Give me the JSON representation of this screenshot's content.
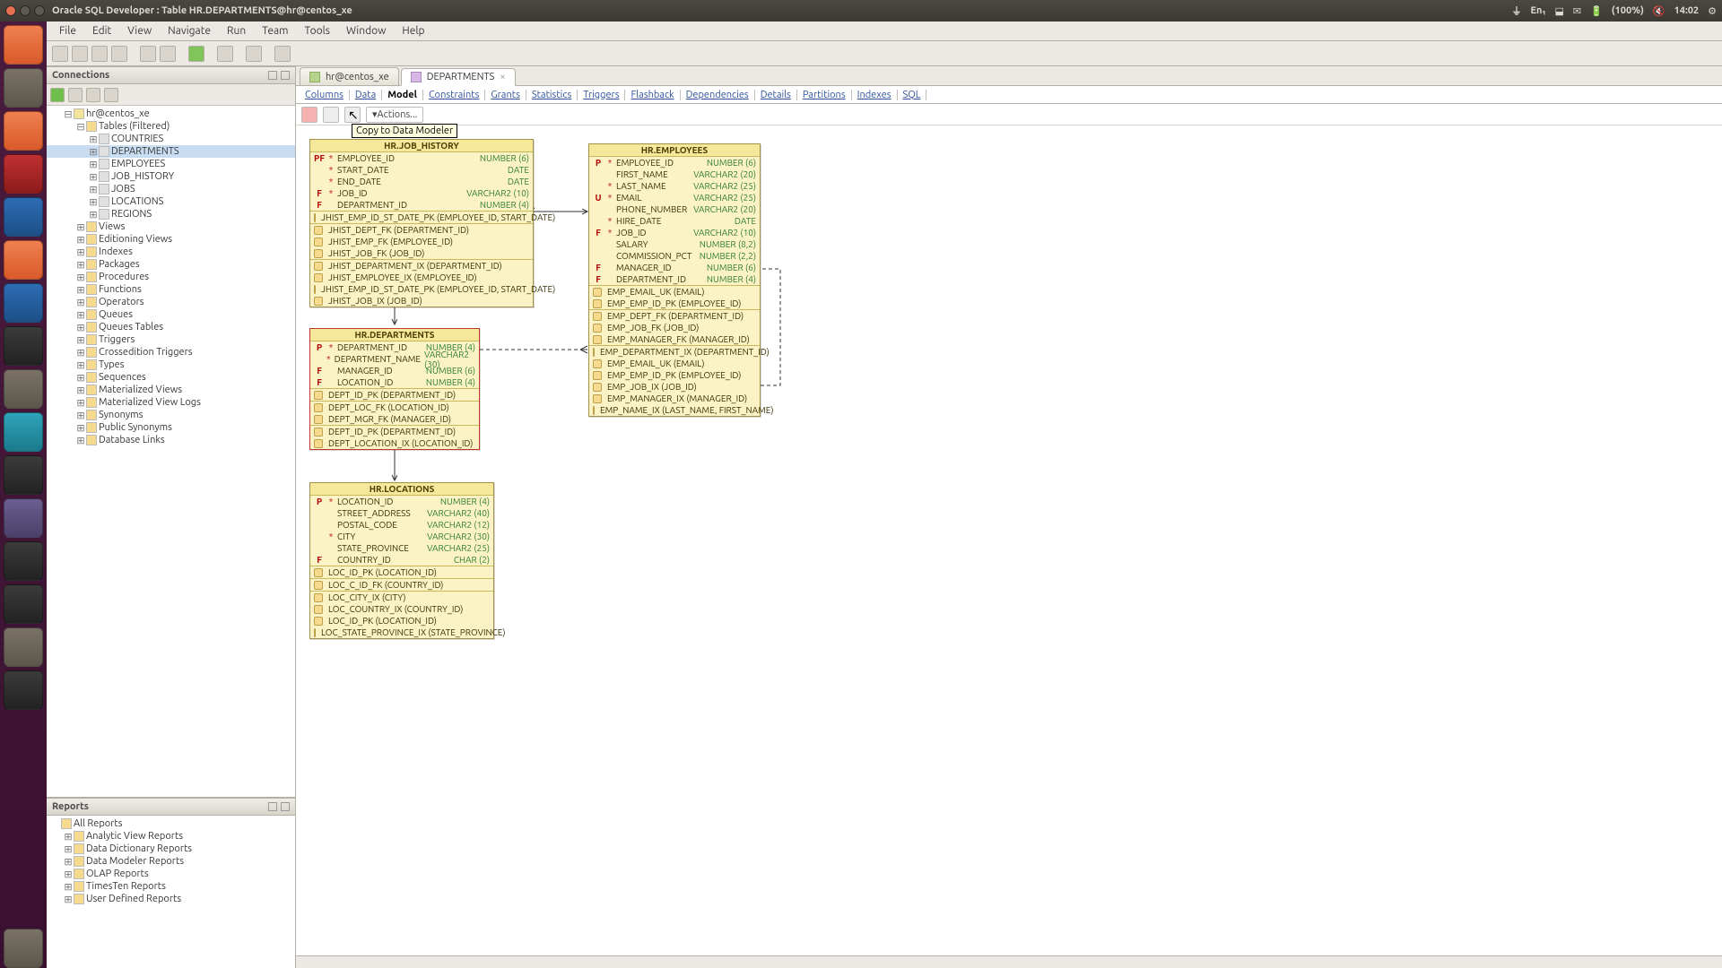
{
  "window": {
    "title": "Oracle SQL Developer : Table HR.DEPARTMENTS@hr@centos_xe"
  },
  "systray": {
    "battery": "(100%)",
    "time": "14:02",
    "lang": "En₁"
  },
  "menubar": [
    "File",
    "Edit",
    "View",
    "Navigate",
    "Run",
    "Team",
    "Tools",
    "Window",
    "Help"
  ],
  "panels": {
    "connections": "Connections",
    "reports": "Reports"
  },
  "tree": {
    "conn": "hr@centos_xe",
    "tables": "Tables (Filtered)",
    "tablelist": [
      "COUNTRIES",
      "DEPARTMENTS",
      "EMPLOYEES",
      "JOB_HISTORY",
      "JOBS",
      "LOCATIONS",
      "REGIONS"
    ],
    "nodes": [
      "Views",
      "Editioning Views",
      "Indexes",
      "Packages",
      "Procedures",
      "Functions",
      "Operators",
      "Queues",
      "Queues Tables",
      "Triggers",
      "Crossedition Triggers",
      "Types",
      "Sequences",
      "Materialized Views",
      "Materialized View Logs",
      "Synonyms",
      "Public Synonyms",
      "Database Links"
    ]
  },
  "reports": [
    "All Reports",
    "Analytic View Reports",
    "Data Dictionary Reports",
    "Data Modeler Reports",
    "OLAP Reports",
    "TimesTen Reports",
    "User Defined Reports"
  ],
  "tabs": {
    "conn": "hr@centos_xe",
    "dept": "DEPARTMENTS"
  },
  "subtabs": [
    "Columns",
    "Data",
    "Model",
    "Constraints",
    "Grants",
    "Statistics",
    "Triggers",
    "Flashback",
    "Dependencies",
    "Details",
    "Partitions",
    "Indexes",
    "SQL"
  ],
  "subtoolbar": {
    "actions": "Actions...",
    "tooltip": "Copy to Data Modeler"
  },
  "entities": {
    "job_history": {
      "title": "HR.JOB_HISTORY",
      "cols": [
        {
          "k": "PF",
          "m": "*",
          "n": "EMPLOYEE_ID",
          "t": "NUMBER (6)"
        },
        {
          "k": "",
          "m": "*",
          "n": "START_DATE",
          "t": "DATE"
        },
        {
          "k": "",
          "m": "*",
          "n": "END_DATE",
          "t": "DATE"
        },
        {
          "k": "F",
          "m": "*",
          "n": "JOB_ID",
          "t": "VARCHAR2 (10)"
        },
        {
          "k": "F",
          "m": "",
          "n": "DEPARTMENT_ID",
          "t": "NUMBER (4)"
        }
      ],
      "pk": [
        "JHIST_EMP_ID_ST_DATE_PK (EMPLOYEE_ID, START_DATE)"
      ],
      "fk": [
        "JHIST_DEPT_FK (DEPARTMENT_ID)",
        "JHIST_EMP_FK (EMPLOYEE_ID)",
        "JHIST_JOB_FK (JOB_ID)"
      ],
      "ix": [
        "JHIST_DEPARTMENT_IX (DEPARTMENT_ID)",
        "JHIST_EMPLOYEE_IX (EMPLOYEE_ID)",
        "JHIST_EMP_ID_ST_DATE_PK (EMPLOYEE_ID, START_DATE)",
        "JHIST_JOB_IX (JOB_ID)"
      ]
    },
    "departments": {
      "title": "HR.DEPARTMENTS",
      "cols": [
        {
          "k": "P",
          "m": "*",
          "n": "DEPARTMENT_ID",
          "t": "NUMBER (4)"
        },
        {
          "k": "",
          "m": "*",
          "n": "DEPARTMENT_NAME",
          "t": "VARCHAR2 (30)"
        },
        {
          "k": "F",
          "m": "",
          "n": "MANAGER_ID",
          "t": "NUMBER (6)"
        },
        {
          "k": "F",
          "m": "",
          "n": "LOCATION_ID",
          "t": "NUMBER (4)"
        }
      ],
      "pk": [
        "DEPT_ID_PK (DEPARTMENT_ID)"
      ],
      "fk": [
        "DEPT_LOC_FK (LOCATION_ID)",
        "DEPT_MGR_FK (MANAGER_ID)"
      ],
      "ix": [
        "DEPT_ID_PK (DEPARTMENT_ID)",
        "DEPT_LOCATION_IX (LOCATION_ID)"
      ]
    },
    "employees": {
      "title": "HR.EMPLOYEES",
      "cols": [
        {
          "k": "P",
          "m": "*",
          "n": "EMPLOYEE_ID",
          "t": "NUMBER (6)"
        },
        {
          "k": "",
          "m": "",
          "n": "FIRST_NAME",
          "t": "VARCHAR2 (20)"
        },
        {
          "k": "",
          "m": "*",
          "n": "LAST_NAME",
          "t": "VARCHAR2 (25)"
        },
        {
          "k": "U",
          "m": "*",
          "n": "EMAIL",
          "t": "VARCHAR2 (25)"
        },
        {
          "k": "",
          "m": "",
          "n": "PHONE_NUMBER",
          "t": "VARCHAR2 (20)"
        },
        {
          "k": "",
          "m": "*",
          "n": "HIRE_DATE",
          "t": "DATE"
        },
        {
          "k": "F",
          "m": "*",
          "n": "JOB_ID",
          "t": "VARCHAR2 (10)"
        },
        {
          "k": "",
          "m": "",
          "n": "SALARY",
          "t": "NUMBER (8,2)"
        },
        {
          "k": "",
          "m": "",
          "n": "COMMISSION_PCT",
          "t": "NUMBER (2,2)"
        },
        {
          "k": "F",
          "m": "",
          "n": "MANAGER_ID",
          "t": "NUMBER (6)"
        },
        {
          "k": "F",
          "m": "",
          "n": "DEPARTMENT_ID",
          "t": "NUMBER (4)"
        }
      ],
      "pk": [
        "EMP_EMAIL_UK (EMAIL)",
        "EMP_EMP_ID_PK (EMPLOYEE_ID)"
      ],
      "fk": [
        "EMP_DEPT_FK (DEPARTMENT_ID)",
        "EMP_JOB_FK (JOB_ID)",
        "EMP_MANAGER_FK (MANAGER_ID)"
      ],
      "ix": [
        "EMP_DEPARTMENT_IX (DEPARTMENT_ID)",
        "EMP_EMAIL_UK (EMAIL)",
        "EMP_EMP_ID_PK (EMPLOYEE_ID)",
        "EMP_JOB_IX (JOB_ID)",
        "EMP_MANAGER_IX (MANAGER_ID)",
        "EMP_NAME_IX (LAST_NAME, FIRST_NAME)"
      ]
    },
    "locations": {
      "title": "HR.LOCATIONS",
      "cols": [
        {
          "k": "P",
          "m": "*",
          "n": "LOCATION_ID",
          "t": "NUMBER (4)"
        },
        {
          "k": "",
          "m": "",
          "n": "STREET_ADDRESS",
          "t": "VARCHAR2 (40)"
        },
        {
          "k": "",
          "m": "",
          "n": "POSTAL_CODE",
          "t": "VARCHAR2 (12)"
        },
        {
          "k": "",
          "m": "*",
          "n": "CITY",
          "t": "VARCHAR2 (30)"
        },
        {
          "k": "",
          "m": "",
          "n": "STATE_PROVINCE",
          "t": "VARCHAR2 (25)"
        },
        {
          "k": "F",
          "m": "",
          "n": "COUNTRY_ID",
          "t": "CHAR (2)"
        }
      ],
      "pk": [
        "LOC_ID_PK (LOCATION_ID)"
      ],
      "fk": [
        "LOC_C_ID_FK (COUNTRY_ID)"
      ],
      "ix": [
        "LOC_CITY_IX (CITY)",
        "LOC_COUNTRY_IX (COUNTRY_ID)",
        "LOC_ID_PK (LOCATION_ID)",
        "LOC_STATE_PROVINCE_IX (STATE_PROVINCE)"
      ]
    }
  }
}
